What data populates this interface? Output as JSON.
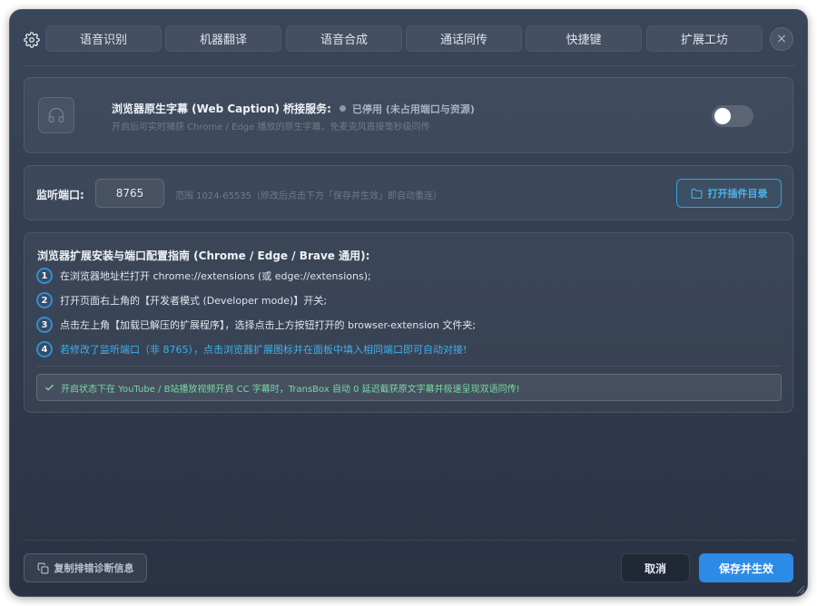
{
  "tabs": [
    {
      "label": "语音识别"
    },
    {
      "label": "机器翻译"
    },
    {
      "label": "语音合成"
    },
    {
      "label": "通话同传"
    },
    {
      "label": "快捷键"
    },
    {
      "label": "扩展工坊"
    }
  ],
  "close_label": "×",
  "service": {
    "title": "浏览器原生字幕 (Web Caption) 桥接服务:",
    "status": "已停用 (未占用端口与资源)",
    "description": "开启后可实时捕获 Chrome / Edge 播放的原生字幕，免麦克风直接毫秒级同传",
    "enabled": false
  },
  "port": {
    "label": "监听端口:",
    "value": "8765",
    "hint": "范围 1024-65535（修改后点击下方「保存并生效」即自动重连）",
    "open_dir_label": "打开插件目录"
  },
  "guide": {
    "title": "浏览器扩展安装与端口配置指南 (Chrome / Edge / Brave 通用):",
    "steps": [
      {
        "num": "1",
        "text": "在浏览器地址栏打开 chrome://extensions (或 edge://extensions);"
      },
      {
        "num": "2",
        "text": "打开页面右上角的【开发者模式 (Developer mode)】开关;"
      },
      {
        "num": "3",
        "text": "点击左上角【加载已解压的扩展程序】，选择点击上方按钮打开的 browser-extension 文件夹;"
      },
      {
        "num": "4",
        "text": "若修改了监听端口（非 8765），点击浏览器扩展图标并在面板中填入相同端口即可自动对接!"
      }
    ],
    "notice": "开启状态下在 YouTube / B站播放视频开启 CC 字幕时，TransBox 自动 0 延迟截获原文字幕并极速呈现双语同传!"
  },
  "footer": {
    "copy_diag_label": "复制排错诊断信息",
    "cancel_label": "取消",
    "save_label": "保存并生效"
  },
  "colors": {
    "accent": "#2d8be8",
    "highlight_text": "#3fb0ec",
    "success_text": "#79d8a2"
  }
}
